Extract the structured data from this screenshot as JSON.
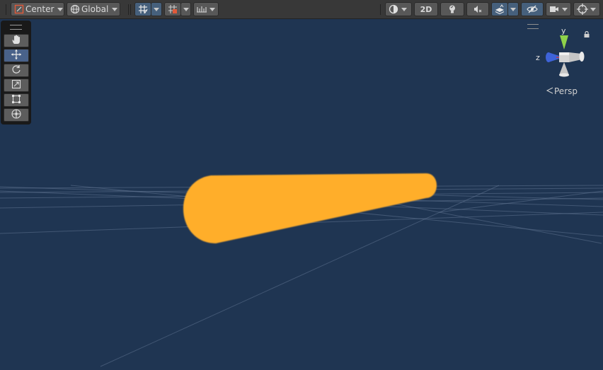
{
  "toolbar": {
    "pivot_label": "Center",
    "space_label": "Global",
    "mode_2d_label": "2D"
  },
  "gizmo": {
    "axis_y": "y",
    "axis_z": "z",
    "projection_label": "Persp"
  },
  "tools": [
    "hand-tool",
    "move-tool",
    "rotate-tool",
    "scale-tool",
    "rect-tool",
    "transform-tool"
  ],
  "colors": {
    "scene_background": "#1f3552",
    "object_color": "#ffae2a",
    "active_tool": "#49628a"
  }
}
